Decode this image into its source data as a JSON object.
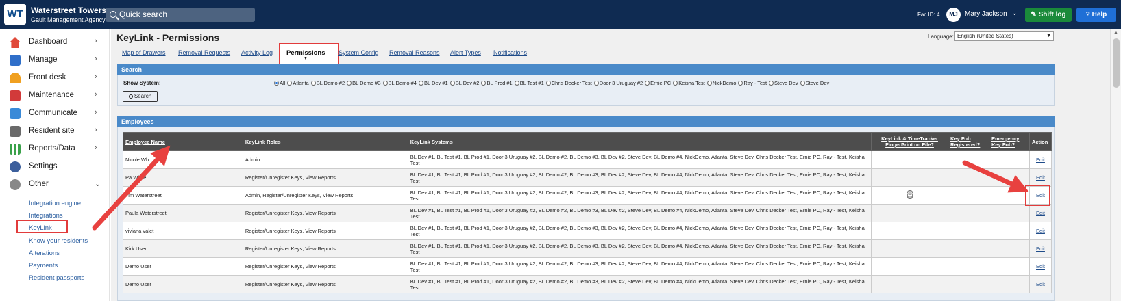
{
  "topbar": {
    "logo": "WT",
    "brand_name": "Waterstreet Towers",
    "brand_sub": "Gault Management Agency",
    "search_placeholder": "Quick search",
    "fac_id": "Fac ID: 4",
    "user_initials": "MJ",
    "user_name": "Mary Jackson",
    "shift_log": "Shift log",
    "help": "Help"
  },
  "sidebar": {
    "items": [
      {
        "label": "Dashboard",
        "icon": "house-icon",
        "color": "#e04a3a"
      },
      {
        "label": "Manage",
        "icon": "building-icon",
        "color": "#2f6fc9"
      },
      {
        "label": "Front desk",
        "icon": "bell-icon",
        "color": "#f0a020"
      },
      {
        "label": "Maintenance",
        "icon": "toolbox-icon",
        "color": "#d23a3a"
      },
      {
        "label": "Communicate",
        "icon": "envelope-icon",
        "color": "#3a8ad8"
      },
      {
        "label": "Resident site",
        "icon": "monitor-icon",
        "color": "#6a6a6a"
      },
      {
        "label": "Reports/Data",
        "icon": "bar-chart-icon",
        "color": "#3aa14a"
      },
      {
        "label": "Settings",
        "icon": "gear-icon",
        "color": "#3c5f9c"
      },
      {
        "label": "Other",
        "icon": "more-icon",
        "color": "#888888"
      }
    ],
    "sub_items": [
      "Integration engine",
      "Integrations",
      "KeyLink",
      "Know your residents",
      "Alterations",
      "Payments",
      "Resident passports"
    ]
  },
  "main": {
    "title": "KeyLink - Permissions",
    "language_label": "Language:",
    "language_value": "English (United States)",
    "tabs": [
      "Map of Drawers",
      "Removal Requests",
      "Activity Log",
      "Permissions",
      "System Config",
      "Removal Reasons",
      "Alert Types",
      "Notifications"
    ]
  },
  "search": {
    "header": "Search",
    "show_system_label": "Show System:",
    "options": [
      "All",
      "Atlanta",
      "BL Demo #2",
      "BL Demo #3",
      "BL Demo #4",
      "BL Dev #1",
      "BL Dev #2",
      "BL Prod #1",
      "BL Test #1",
      "Chris Decker Test",
      "Door 3 Uruguay #2",
      "Ernie PC",
      "Keisha Test",
      "NickDemo",
      "Ray - Test",
      "Steve Dev",
      "Steve Dev"
    ],
    "selected": "All",
    "button": "Search"
  },
  "employees": {
    "header": "Employees",
    "columns": [
      "Employee Name",
      "KeyLink Roles",
      "KeyLink Systems",
      "KeyLink & TimeTracker FingerPrint on File?",
      "Key Fob Registered?",
      "Emergency Key Fob?",
      "Action"
    ],
    "systems_text": "BL Dev #1, BL Test #1, BL Prod #1, Door 3 Uruguay #2, BL Demo #2, BL Demo #3, BL Dev #2, Steve Dev, BL Demo #4, NickDemo, Atlanta, Steve Dev, Chris Decker Test, Ernie PC, Ray - Test, Keisha Test",
    "action_label": "Edit",
    "rows": [
      {
        "name": "Nicole Wh",
        "roles": "Admin",
        "fingerprint": false
      },
      {
        "name": "Pa White",
        "roles": "Register/Unregister Keys, View Reports",
        "fingerprint": false
      },
      {
        "name": "Tim Waterstreet",
        "roles": "Admin, Register/Unregister Keys, View Reports",
        "fingerprint": true
      },
      {
        "name": "Paula Waterstreet",
        "roles": "Register/Unregister Keys, View Reports",
        "fingerprint": false
      },
      {
        "name": "viviana valet",
        "roles": "Register/Unregister Keys, View Reports",
        "fingerprint": false
      },
      {
        "name": "Kirk User",
        "roles": "Register/Unregister Keys, View Reports",
        "fingerprint": false
      },
      {
        "name": "Demo User",
        "roles": "Register/Unregister Keys, View Reports",
        "fingerprint": false
      },
      {
        "name": "Demo User",
        "roles": "Register/Unregister Keys, View Reports",
        "fingerprint": false
      }
    ]
  },
  "colors": {
    "topbar": "#0f2b52",
    "panel_header": "#4a8ac9",
    "table_header": "#4d4d4d",
    "highlight": "#e23b3b"
  }
}
